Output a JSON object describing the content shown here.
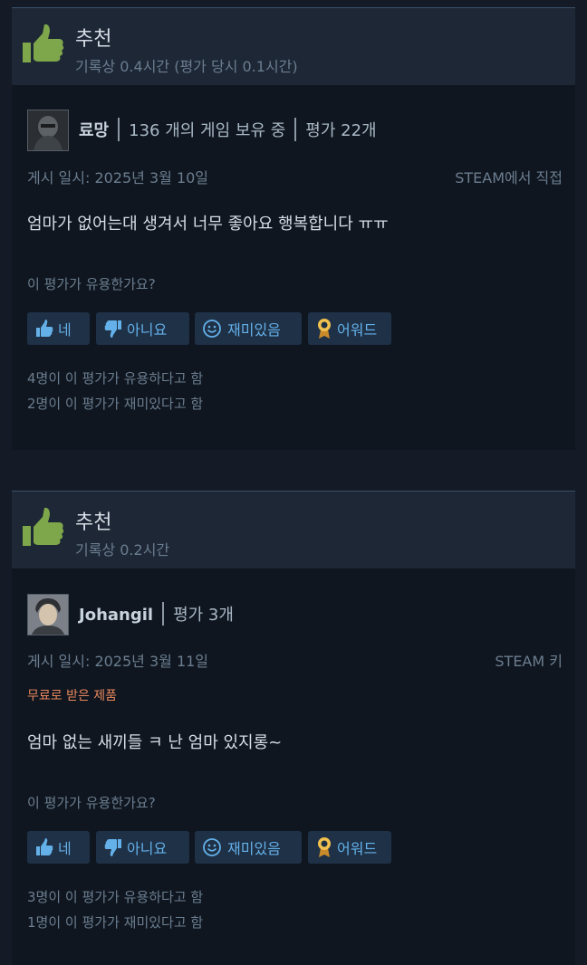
{
  "colors": {
    "accent": "#64b1ea",
    "thumb_green": "#7ea64b",
    "free_orange": "#e8875e"
  },
  "reviews": [
    {
      "verdict": "추천",
      "hours": "기록상 0.4시간 (평가 당시 0.1시간)",
      "author": "료망",
      "games_owned": "136 개의 게임 보유 중",
      "review_count": "평가 22개",
      "posted": "게시 일시: 2025년 3월 10일",
      "source": "STEAM에서 직접",
      "text": "엄마가 없어는대 생겨서 너무 좋아요 행복합니다 ㅠㅠ",
      "question": "이 평가가 유용한가요?",
      "buttons": {
        "yes": "네",
        "no": "아니요",
        "funny": "재미있음",
        "award": "어워드"
      },
      "helpful": "4명이 이 평가가 유용하다고 함",
      "funny_count": "2명이 이 평가가 재미있다고 함"
    },
    {
      "verdict": "추천",
      "hours": "기록상 0.2시간",
      "author": "Johangil",
      "review_count": "평가 3개",
      "posted": "게시 일시: 2025년 3월 11일",
      "source": "STEAM 키",
      "free_note": "무료로 받은 제품",
      "text": "엄마 없는 새끼들 ㅋ 난 엄마 있지롱~",
      "question": "이 평가가 유용한가요?",
      "buttons": {
        "yes": "네",
        "no": "아니요",
        "funny": "재미있음",
        "award": "어워드"
      },
      "helpful": "3명이 이 평가가 유용하다고 함",
      "funny_count": "1명이 이 평가가 재미있다고 함"
    }
  ]
}
